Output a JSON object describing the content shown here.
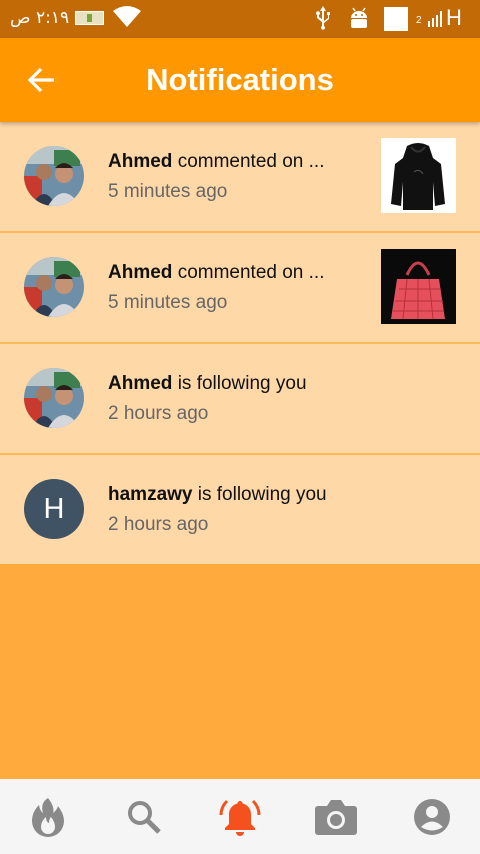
{
  "status_bar": {
    "time": "٢:١٩ ص",
    "signal_number": "2",
    "network_type": "H"
  },
  "app_bar": {
    "title": "Notifications",
    "back_icon": "arrow-left-icon"
  },
  "notifications": [
    {
      "user": "Ahmed",
      "action": "commented on ...",
      "time": "5 minutes ago",
      "avatar": "photo",
      "thumbnail": "black-hoodie"
    },
    {
      "user": "Ahmed",
      "action": "commented on ...",
      "time": "5 minutes ago",
      "avatar": "photo",
      "thumbnail": "pink-handbag"
    },
    {
      "user": "Ahmed",
      "action": "is following you",
      "time": "2 hours ago",
      "avatar": "photo"
    },
    {
      "user": "hamzawy",
      "action": "is following you",
      "time": "2 hours ago",
      "avatar_letter": "H"
    }
  ],
  "bottom_nav": [
    {
      "icon": "flame-icon",
      "active": false
    },
    {
      "icon": "search-icon",
      "active": false
    },
    {
      "icon": "bell-icon",
      "active": true
    },
    {
      "icon": "camera-icon",
      "active": false
    },
    {
      "icon": "account-icon",
      "active": false
    }
  ],
  "colors": {
    "app_bar": "#FF9800",
    "status_bar": "#C26A05",
    "item_bg": "#FFD8A8",
    "page_bg": "#FFAA3C",
    "active_nav": "#F4511E",
    "inactive_nav": "#8A8A8A"
  }
}
